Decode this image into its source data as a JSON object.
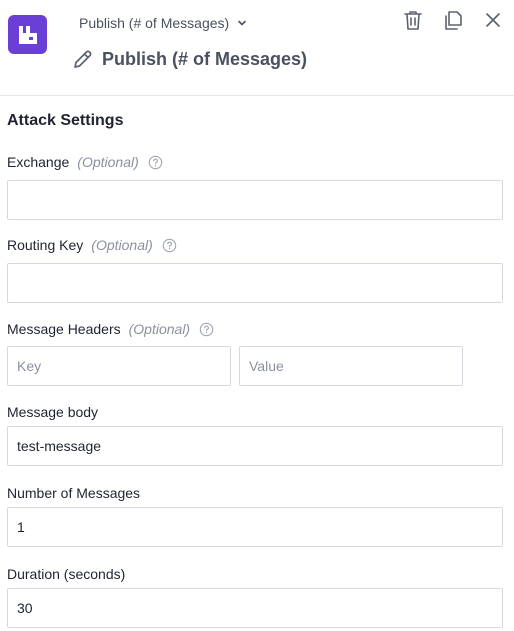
{
  "header": {
    "selector_label": "Publish (# of Messages)",
    "title": "Publish (# of Messages)",
    "brand_color": "#6a3fd6",
    "icons": [
      "trash-icon",
      "copy-icon",
      "close-icon",
      "pencil-icon",
      "chevron-down-icon"
    ]
  },
  "settings": {
    "section_title": "Attack Settings",
    "exchange": {
      "label": "Exchange",
      "optional": "(Optional)",
      "value": ""
    },
    "routing_key": {
      "label": "Routing Key",
      "optional": "(Optional)",
      "value": ""
    },
    "message_headers": {
      "label": "Message Headers",
      "optional": "(Optional)",
      "key_placeholder": "Key",
      "value_placeholder": "Value"
    },
    "message_body": {
      "label": "Message body",
      "value": "test-message"
    },
    "number_of_messages": {
      "label": "Number of Messages",
      "value": "1"
    },
    "duration": {
      "label": "Duration (seconds)",
      "value": "30"
    }
  }
}
